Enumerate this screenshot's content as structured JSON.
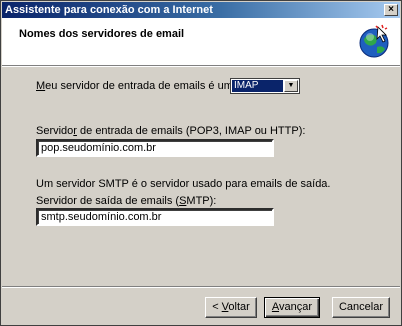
{
  "window": {
    "title": "Assistente para conexão com a Internet",
    "close_glyph": "×"
  },
  "header": {
    "title": "Nomes dos servidores de email",
    "icon": "internet-connection-wizard-icon"
  },
  "incoming_type": {
    "label_prefix": "M",
    "label_rest": "eu servidor de entrada de emails é um  servidor",
    "selected": "IMAP"
  },
  "incoming_server": {
    "label_prefix": "Servido",
    "label_accel": "r",
    "label_rest": " de entrada de emails (POP3, IMAP ou HTTP):",
    "value": "pop.seudomínio.com.br"
  },
  "smtp_note": "Um servidor SMTP é o servidor usado para emails de saída.",
  "outgoing_server": {
    "label_prefix": "Servidor de saída de emails (",
    "label_accel": "S",
    "label_rest": "MTP):",
    "value": "smtp.seudomínio.com.br"
  },
  "buttons": {
    "back": {
      "prefix": "< ",
      "accel": "V",
      "rest": "oltar"
    },
    "next": {
      "accel": "A",
      "rest": "vançar"
    },
    "cancel": "Cancelar"
  }
}
